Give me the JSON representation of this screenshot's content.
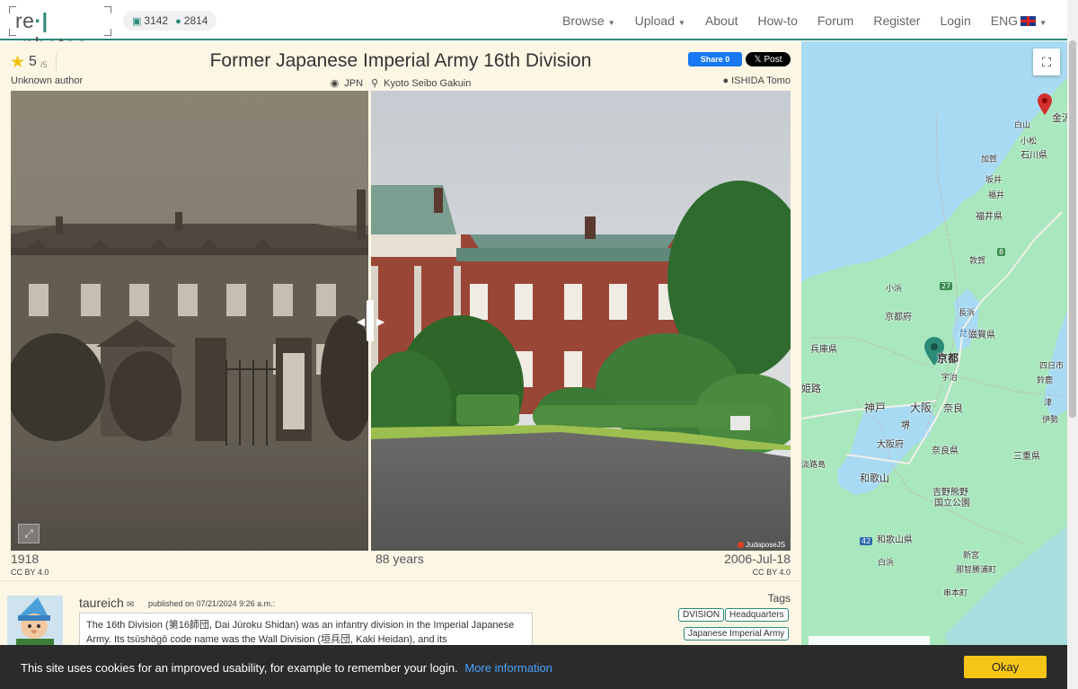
{
  "header": {
    "logo_left": "re",
    "logo_right": "photos",
    "photo_count": "3142",
    "user_count": "2814",
    "nav": {
      "browse": "Browse",
      "upload": "Upload",
      "about": "About",
      "howto": "How-to",
      "forum": "Forum",
      "register": "Register",
      "login": "Login",
      "lang": "ENG"
    }
  },
  "photo": {
    "rating": "5",
    "rating_of": "/5",
    "author": "Unknown author",
    "title": "Former Japanese Imperial Army 16th Division",
    "country": "JPN",
    "location": "Kyoto Seibo Gakuin",
    "owner": "ISHIDA Tomo",
    "share_label": "Share 0",
    "post_label": "Post",
    "old_year": "1918",
    "old_license": "CC BY 4.0",
    "span": "88 years",
    "new_date": "2006-Jul-18",
    "new_license": "CC BY 4.0",
    "watermark": "JudaposeJS",
    "expand_icon": "expand-icon"
  },
  "comment": {
    "user": "taureich",
    "published": "published on 07/21/2024 9:26 a.m.:",
    "text": "The 16th Division (第16師団, Dai Jūroku Shidan) was an infantry division in the Imperial Japanese Army. Its tsūshōgō code name was the Wall Division (垣兵団, Kaki Heidan), and its"
  },
  "tags": {
    "heading": "Tags",
    "items": [
      "DVISION",
      "Headquarters",
      "Japanese Imperial Army"
    ]
  },
  "map": {
    "labels": {
      "kanazawa": "金沢",
      "hakusan": "白山",
      "komatsu": "小松",
      "kaga": "加賀",
      "ishikawa": "石川県",
      "sakai": "坂井",
      "fukui_city": "福井",
      "fukui": "福井県",
      "tsuruga": "敦賀",
      "obama": "小浜",
      "kyoto_pref": "京都府",
      "nagahama": "長浜",
      "biwako": "琵琶湖",
      "shiga": "滋賀県",
      "hyogo": "兵庫県",
      "kyoto": "京都",
      "uji": "宇治",
      "himeji": "姫路",
      "kobe": "神戸",
      "osaka": "大阪",
      "nara": "奈良",
      "sakai_city": "堺",
      "osaka_pref": "大阪府",
      "nara_pref": "奈良県",
      "awaji": "淡路島",
      "wakayama": "和歌山",
      "mie": "三重県",
      "yoshino": "吉野熊野",
      "kokuritsu": "国立公園",
      "wakayama_pref": "和歌山県",
      "shingu": "新宮",
      "nachi": "那智勝浦町",
      "shirahama": "白浜",
      "kushimoto": "串本町",
      "yokkaichi": "四日市",
      "tsu": "津",
      "suzuka": "鈴鹿",
      "ise": "伊勢",
      "r27": "27",
      "r42": "42",
      "r8": "8"
    },
    "fullscreen_icon": "fullscreen-icon"
  },
  "cookie": {
    "message": "This site uses cookies for an improved usability, for example to remember your login.",
    "more": "More information",
    "ok": "Okay"
  },
  "colors": {
    "accent": "#2b8a78",
    "panel_bg": "#fcf6e4",
    "map_water": "#a8daf3",
    "map_land": "#a9e7be",
    "okay_button": "#f5c518"
  }
}
